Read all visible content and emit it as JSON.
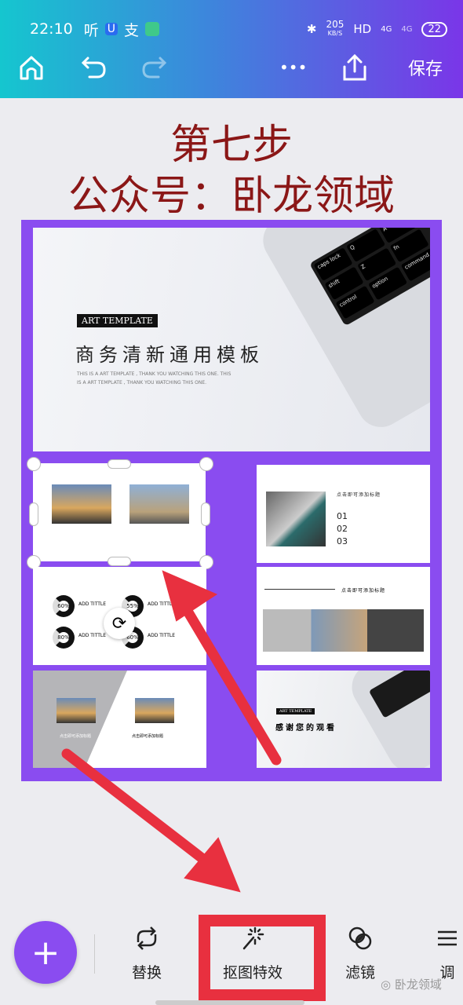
{
  "status_bar": {
    "time": "22:10",
    "app_icons": [
      "听",
      "U",
      "支",
      "chat"
    ],
    "net_speed": "205",
    "net_unit": "KB/S",
    "hd": "HD",
    "sig1": "4G",
    "sig2": "4G",
    "battery": "22"
  },
  "toolbar": {
    "home": "home-icon",
    "undo": "undo-icon",
    "redo": "redo-icon",
    "more": "•••",
    "share": "share-icon",
    "save_label": "保存"
  },
  "heading": {
    "line1": "第七步",
    "line2": "公众号：卧龙领域",
    "color": "#8b1717"
  },
  "canvas": {
    "bg_color": "#8a4cf0",
    "cover": {
      "tag": "ART TEMPLATE",
      "title": "商务清新通用模板",
      "sub1": "THIS IS A ART TEMPLATE , THANK YOU WATCHING THIS ONE. THIS",
      "sub2": "IS A ART TEMPLATE , THANK YOU WATCHING THIS ONE.",
      "keys": [
        "caps lock",
        "shift",
        "fn",
        "control",
        "option",
        "command",
        "Q",
        "A",
        "Z"
      ]
    },
    "slide_list": {
      "title": "点击即可添加标题",
      "nums": [
        "01",
        "02",
        "03"
      ]
    },
    "slide_stats": {
      "items": [
        {
          "pct": "60%",
          "title": "ADD TITTLE"
        },
        {
          "pct": "55%",
          "title": "ADD TITTLE"
        },
        {
          "pct": "80%",
          "title": "ADD TITTLE"
        },
        {
          "pct": "60%",
          "title": "ADD TITTLE"
        }
      ]
    },
    "slide_banner": {
      "title": "点击即可添加标题"
    },
    "slide_split": {
      "left": "点击即可添加标题",
      "right": "点击即可添加标题"
    },
    "slide_end": {
      "tag": "ART TEMPLATE",
      "title": "感谢您的观看"
    }
  },
  "bottom": {
    "add": "+",
    "items": [
      {
        "label": "替换",
        "icon": "replace-icon"
      },
      {
        "label": "抠图特效",
        "icon": "magic-wand-icon"
      },
      {
        "label": "滤镜",
        "icon": "filter-icon"
      },
      {
        "label": "调",
        "icon": "adjust-icon"
      }
    ],
    "watermark": "卧龙领域",
    "highlight_color": "#e8303f"
  }
}
